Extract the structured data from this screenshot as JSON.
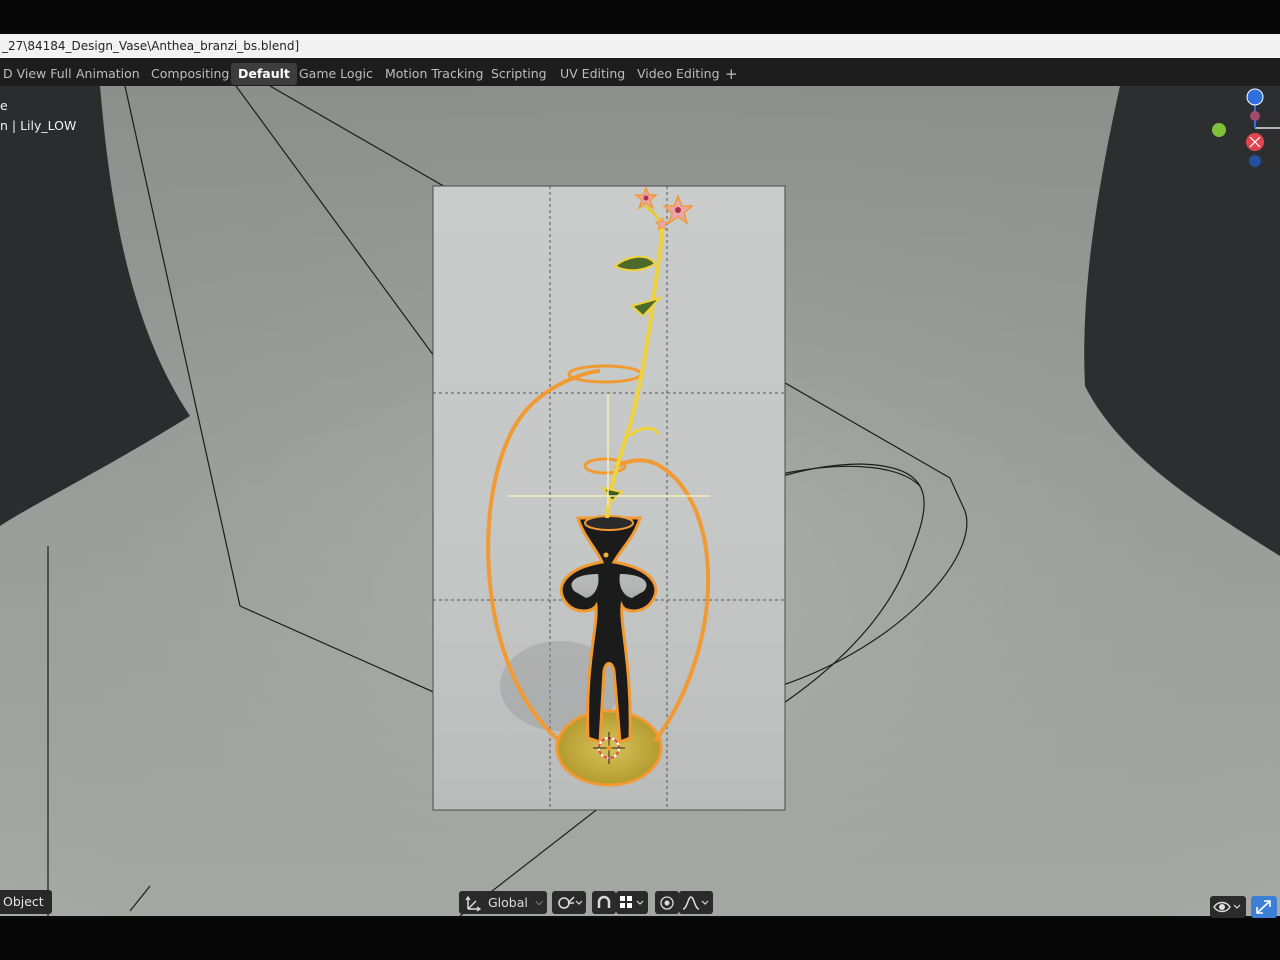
{
  "window": {
    "file_path": "_27\\84184_Design_Vase\\Anthea_branzi_bs.blend]"
  },
  "workspace_tabs": [
    {
      "label": "D View Full",
      "active": false
    },
    {
      "label": "Animation",
      "active": false
    },
    {
      "label": "Compositing",
      "active": false
    },
    {
      "label": "Default",
      "active": true
    },
    {
      "label": "Game Logic",
      "active": false
    },
    {
      "label": "Motion Tracking",
      "active": false
    },
    {
      "label": "Scripting",
      "active": false
    },
    {
      "label": "UV Editing",
      "active": false
    },
    {
      "label": "Video Editing",
      "active": false
    }
  ],
  "add_tab_label": "+",
  "viewport_info": {
    "line1": "e",
    "line2": "n | Lily_LOW"
  },
  "header": {
    "mode_label": "Object",
    "transform_orientation": "Global"
  },
  "colors": {
    "selection_orange": "#f29a32",
    "axis_x": "#e0454f",
    "axis_y": "#7fc23a",
    "axis_z": "#2f6fe0",
    "active_blue": "#3d7fd6"
  },
  "icons": {
    "orientation": "transform-orientation-icon",
    "pivot": "pivot-point-icon",
    "snap": "snap-magnet-icon",
    "snap_target": "snap-increment-icon",
    "proportional": "proportional-editing-icon",
    "falloff": "falloff-curve-icon",
    "visibility": "eye-icon",
    "gizmo": "gizmo-toggle-icon"
  }
}
